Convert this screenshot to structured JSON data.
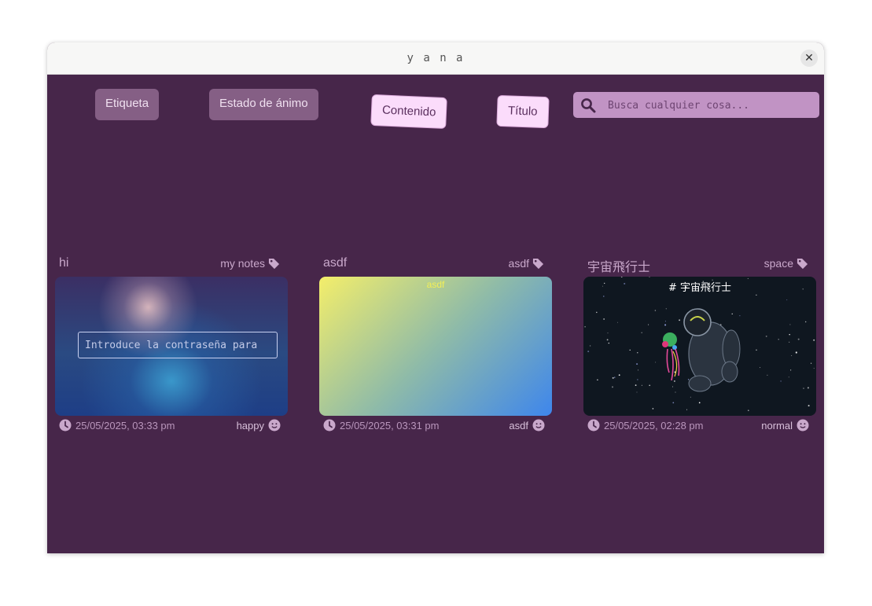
{
  "window": {
    "title": "y a n a",
    "close_glyph": "✕"
  },
  "filters": [
    {
      "label": "Etiqueta",
      "active": false
    },
    {
      "label": "Estado de ánimo",
      "active": false
    },
    {
      "label": "Contenido",
      "active": true
    },
    {
      "label": "Título",
      "active": true
    }
  ],
  "search": {
    "placeholder": "Busca cualquier cosa...",
    "value": "",
    "icon": "search-icon"
  },
  "colors": {
    "background": "#47264a",
    "accent": "#c193c4",
    "chip_active": "#fbdcfb",
    "chip_inactive": "#855f85"
  },
  "notes": [
    {
      "title": "hi",
      "tag": "my notes",
      "preview_type": "locked",
      "password_placeholder": "Introduce la contraseña para",
      "date": "25/05/2025, 03:33 pm",
      "mood": "happy"
    },
    {
      "title": "asdf",
      "tag": "asdf",
      "preview_type": "gradient",
      "preview_text": "asdf",
      "date": "25/05/2025, 03:31 pm",
      "mood": "asdf"
    },
    {
      "title": "宇宙飛行士",
      "tag": "space",
      "preview_type": "image",
      "preview_text": "# 宇宙飛行士",
      "date": "25/05/2025, 02:28 pm",
      "mood": "normal"
    }
  ]
}
